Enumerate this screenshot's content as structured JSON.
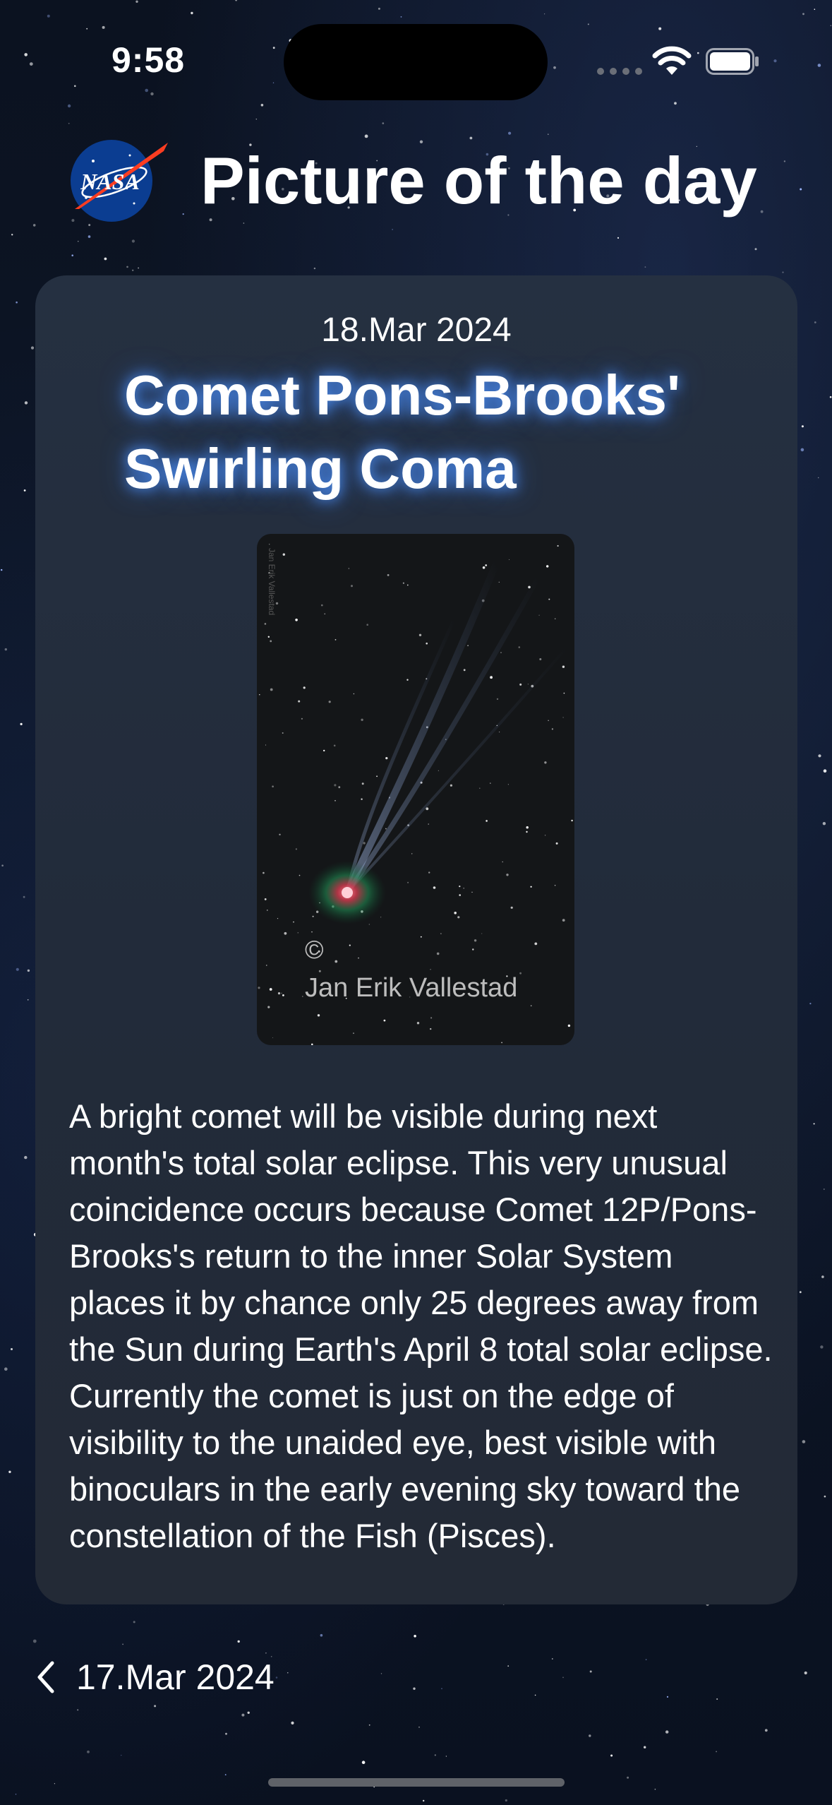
{
  "status_bar": {
    "time": "9:58"
  },
  "header": {
    "title": "Picture of the day",
    "logo_text": "NASA"
  },
  "apod": {
    "date": "18.Mar 2024",
    "title": "Comet Pons-Brooks' Swirling Coma",
    "copyright_symbol": "©",
    "photographer": "Jan Erik Vallestad",
    "explanation": "A bright comet will be visible during next month's total solar eclipse.  This very unusual coincidence occurs because Comet 12P/Pons-Brooks's return to the inner Solar System places it by chance only 25 degrees away from the Sun during Earth's April 8 total solar eclipse.  Currently the comet is just on the edge of visibility to the unaided eye, best visible with binoculars in the early evening sky toward the constellation of the Fish (Pisces)."
  },
  "navigation": {
    "previous_date": "17.Mar 2024"
  },
  "colors": {
    "card": "#232c3a",
    "title_glow": "#4f8fff",
    "nasa_blue": "#0b3d91",
    "nasa_red": "#fc3d21"
  }
}
